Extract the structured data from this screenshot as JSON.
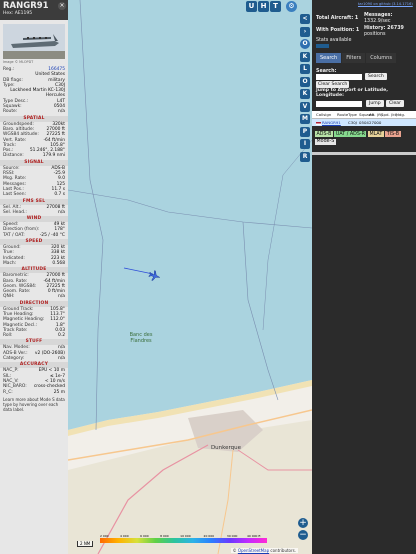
{
  "aircraft": {
    "callsign": "RANGR91",
    "hex_label": "Hex:",
    "hex": "AE1195",
    "photo_caption": "Image © MLOPDT"
  },
  "details": [
    {
      "k": "Reg.:",
      "v": "166475",
      "link": true
    },
    {
      "k": "",
      "v": "United States"
    },
    {
      "k": "DB flags:",
      "v": "military"
    },
    {
      "k": "Type:",
      "v": "C30J"
    },
    {
      "k": "",
      "v": "Lockheed Martin KC-130J Hercules"
    },
    {
      "k": "Type Desc.:",
      "v": "L4T"
    },
    {
      "k": "Squawk:",
      "v": "0504"
    },
    {
      "k": "Route:",
      "v": "n/a"
    }
  ],
  "sections": [
    {
      "title": "SPATIAL",
      "rows": [
        {
          "k": "Groundspeed:",
          "v": "320kt"
        },
        {
          "k": "Baro. altitude:",
          "v": "27000 ft"
        },
        {
          "k": "WGS84 altitude:",
          "v": "27225 ft"
        },
        {
          "k": "Vert. Rate:",
          "v": "-64 ft/min"
        },
        {
          "k": "Track:",
          "v": "105.8°"
        },
        {
          "k": "Pos.:",
          "v": "51.246°, 2.188°"
        },
        {
          "k": "Distance:",
          "v": "179.9 nmi"
        }
      ]
    },
    {
      "title": "SIGNAL",
      "rows": [
        {
          "k": "Source:",
          "v": "ADS-B"
        },
        {
          "k": "RSSI:",
          "v": "-25.9"
        },
        {
          "k": "Msg. Rate:",
          "v": "9.0"
        },
        {
          "k": "Messages:",
          "v": "125"
        },
        {
          "k": "Last Pos.:",
          "v": "11.7 s"
        },
        {
          "k": "Last Seen:",
          "v": "0.7 s"
        }
      ]
    },
    {
      "title": "FMS SEL",
      "rows": [
        {
          "k": "Sel. Alt.:",
          "v": "27008 ft"
        },
        {
          "k": "Sel. Head.:",
          "v": "n/a"
        }
      ]
    },
    {
      "title": "WIND",
      "rows": [
        {
          "k": "Speed:",
          "v": "49 kt"
        },
        {
          "k": "Direction (from):",
          "v": "178°"
        },
        {
          "k": "TAT / OAT:",
          "v": "-25 / -40 °C"
        }
      ]
    },
    {
      "title": "SPEED",
      "rows": [
        {
          "k": "Ground:",
          "v": "320 kt"
        },
        {
          "k": "True:",
          "v": "338 kt"
        },
        {
          "k": "Indicated:",
          "v": "223 kt"
        },
        {
          "k": "Mach:",
          "v": "0.568"
        }
      ]
    },
    {
      "title": "ALTITUDE",
      "rows": [
        {
          "k": "Barometric:",
          "v": "27000 ft"
        },
        {
          "k": "Baro. Rate:",
          "v": "-64 ft/min"
        },
        {
          "k": "Geom. WGS84:",
          "v": "27225 ft"
        },
        {
          "k": "Geom. Rate:",
          "v": "0 ft/min"
        },
        {
          "k": "QNH:",
          "v": "n/a"
        }
      ]
    },
    {
      "title": "DIRECTION",
      "rows": [
        {
          "k": "Ground Track:",
          "v": "105.8°"
        },
        {
          "k": "True Heading:",
          "v": "113.7°"
        },
        {
          "k": "Magnetic Heading:",
          "v": "112.0°"
        },
        {
          "k": "Magnetic Decl.:",
          "v": "1.8°"
        },
        {
          "k": "Track Rate:",
          "v": "0.03"
        },
        {
          "k": "Roll:",
          "v": "0.2"
        }
      ]
    },
    {
      "title": "STUFF",
      "rows": [
        {
          "k": "Nav. Modes:",
          "v": "n/a"
        },
        {
          "k": "ADS-B Ver.:",
          "v": "v2 (DO-260B)"
        },
        {
          "k": "Category:",
          "v": "n/a"
        }
      ]
    },
    {
      "title": "ACCURACY",
      "rows": [
        {
          "k": "NAC_P:",
          "v": "EPU < 10 m"
        },
        {
          "k": "SIL:",
          "v": "≤ 1e-7"
        },
        {
          "k": "NAC_V:",
          "v": "< 10 m/s"
        },
        {
          "k": "NIC_BARO:",
          "v": "cross-checked"
        },
        {
          "k": "R_C:",
          "v": "25 m"
        }
      ]
    }
  ],
  "footer_text": "Learn more about Mode S data type by hovering over each data label.",
  "map": {
    "top_buttons": [
      "U",
      "H",
      "T"
    ],
    "label_bank": "Banc des Flandres",
    "label_city": "Dunkerque",
    "zoom_in": "+",
    "zoom_out": "−",
    "scale": "2 NM",
    "alt_ticks": [
      "2 000",
      "4 000",
      "6 000",
      "8 000",
      "10 000",
      "20 000",
      "30 000",
      "40 000 ft"
    ],
    "attribution_prefix": "© ",
    "attribution_link": "OpenStreetMap",
    "attribution_suffix": " contributors."
  },
  "side_buttons": [
    "<",
    "›",
    "O",
    "K",
    "L",
    "O",
    "K",
    "V",
    "M",
    "P",
    "I",
    "R"
  ],
  "right_panel": {
    "version": "tar1090 on github (3.14.1716)",
    "total_label": "Total Aircraft: 1",
    "messages_label": "Messages:",
    "messages_value": "1332.9/sec",
    "position_label": "With Position: 1",
    "history_label": "History: 26739",
    "history_value": "positions",
    "stats_link": "Stats available",
    "tabs": [
      "Search",
      "Filters",
      "Columns"
    ],
    "search_label": "Search:",
    "search_button": "Search",
    "clear_button": "Clear Search",
    "jump_label": "Jump to Airport or Latitude, Longitude:",
    "jump_button": "Jump",
    "clear_button2": "Clear",
    "table_headers": [
      "",
      "Callsign",
      "Route",
      "Type",
      "Squawk",
      "Alt. (ft)",
      "Spd. (kt)",
      "Hdg.",
      ""
    ],
    "table_rows": [
      [
        "",
        "RANGR91",
        "",
        "C30J",
        "0504",
        "27000",
        "",
        "",
        ""
      ]
    ],
    "badges": [
      {
        "label": "ADS-B",
        "color": "#b9e3a8"
      },
      {
        "label": "UAT / ADS-R",
        "color": "#86d98e"
      },
      {
        "label": "MLAT",
        "color": "#e8d39a"
      },
      {
        "label": "TIS-B",
        "color": "#e9a28f"
      },
      {
        "label": "Mode-S",
        "color": "#e6e6e6"
      }
    ]
  }
}
